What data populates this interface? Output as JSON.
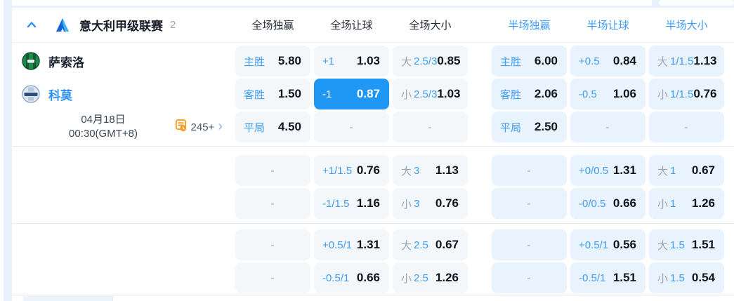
{
  "header": {
    "league": "意大利甲级联赛",
    "count": "2",
    "columns": [
      "全场独赢",
      "全场让球",
      "全场大小",
      "半场独赢",
      "半场让球",
      "半场大小"
    ]
  },
  "match": {
    "home": "萨索洛",
    "away": "科莫",
    "date_line1": "04月18日",
    "date_line2": "00:30(GMT+8)",
    "more_markets": "245+",
    "more_chevron": "›"
  },
  "colors": {
    "accent_blue": "#1f97f4",
    "label_blue": "#3d9cf5",
    "half_cell_bg": "#e9f3fd",
    "full_cell_bg": "#f4f7fa",
    "orange_icon": "#f79c27",
    "selected_text": "#ffffff"
  },
  "odds": {
    "sections": [
      {
        "rows": [
          [
            {
              "type": "win",
              "label": "主胜",
              "value": "5.80"
            },
            {
              "type": "hcp",
              "line": "+1",
              "value": "1.03"
            },
            {
              "type": "ou",
              "side": "大",
              "line": "2.5/3",
              "value": "0.85"
            },
            {
              "type": "win",
              "label": "主胜",
              "value": "6.00",
              "half": true
            },
            {
              "type": "hcp",
              "line": "+0.5",
              "value": "0.84",
              "half": true
            },
            {
              "type": "ou",
              "side": "大",
              "line": "1/1.5",
              "value": "1.13",
              "half": true
            }
          ],
          [
            {
              "type": "win",
              "label": "客胜",
              "value": "1.50"
            },
            {
              "type": "hcp",
              "line": "-1",
              "value": "0.87",
              "selected": true
            },
            {
              "type": "ou",
              "side": "小",
              "line": "2.5/3",
              "value": "1.03"
            },
            {
              "type": "win",
              "label": "客胜",
              "value": "2.06",
              "half": true
            },
            {
              "type": "hcp",
              "line": "-0.5",
              "value": "1.06",
              "half": true
            },
            {
              "type": "ou",
              "side": "小",
              "line": "1/1.5",
              "value": "0.76",
              "half": true
            }
          ],
          [
            {
              "type": "win",
              "label": "平局",
              "value": "4.50"
            },
            {
              "type": "empty"
            },
            {
              "type": "empty"
            },
            {
              "type": "win",
              "label": "平局",
              "value": "2.50",
              "half": true
            },
            {
              "type": "empty",
              "half": true
            },
            {
              "type": "empty",
              "half": true
            }
          ]
        ]
      },
      {
        "rows": [
          [
            {
              "type": "empty"
            },
            {
              "type": "hcp",
              "line": "+1/1.5",
              "value": "0.76"
            },
            {
              "type": "ou",
              "side": "大",
              "line": "3",
              "value": "1.13"
            },
            {
              "type": "empty",
              "half": true
            },
            {
              "type": "hcp",
              "line": "+0/0.5",
              "value": "1.31",
              "half": true
            },
            {
              "type": "ou",
              "side": "大",
              "line": "1",
              "value": "0.67",
              "half": true
            }
          ],
          [
            {
              "type": "empty"
            },
            {
              "type": "hcp",
              "line": "-1/1.5",
              "value": "1.16"
            },
            {
              "type": "ou",
              "side": "小",
              "line": "3",
              "value": "0.76"
            },
            {
              "type": "empty",
              "half": true
            },
            {
              "type": "hcp",
              "line": "-0/0.5",
              "value": "0.66",
              "half": true
            },
            {
              "type": "ou",
              "side": "小",
              "line": "1",
              "value": "1.26",
              "half": true
            }
          ]
        ]
      },
      {
        "rows": [
          [
            {
              "type": "empty"
            },
            {
              "type": "hcp",
              "line": "+0.5/1",
              "value": "1.31"
            },
            {
              "type": "ou",
              "side": "大",
              "line": "2.5",
              "value": "0.67"
            },
            {
              "type": "empty",
              "half": true
            },
            {
              "type": "hcp",
              "line": "+0.5/1",
              "value": "0.56",
              "half": true
            },
            {
              "type": "ou",
              "side": "大",
              "line": "1.5",
              "value": "1.51",
              "half": true
            }
          ],
          [
            {
              "type": "empty"
            },
            {
              "type": "hcp",
              "line": "-0.5/1",
              "value": "0.66"
            },
            {
              "type": "ou",
              "side": "小",
              "line": "2.5",
              "value": "1.26"
            },
            {
              "type": "empty",
              "half": true
            },
            {
              "type": "hcp",
              "line": "-0.5/1",
              "value": "1.51",
              "half": true
            },
            {
              "type": "ou",
              "side": "小",
              "line": "1.5",
              "value": "0.54",
              "half": true
            }
          ]
        ]
      }
    ]
  }
}
